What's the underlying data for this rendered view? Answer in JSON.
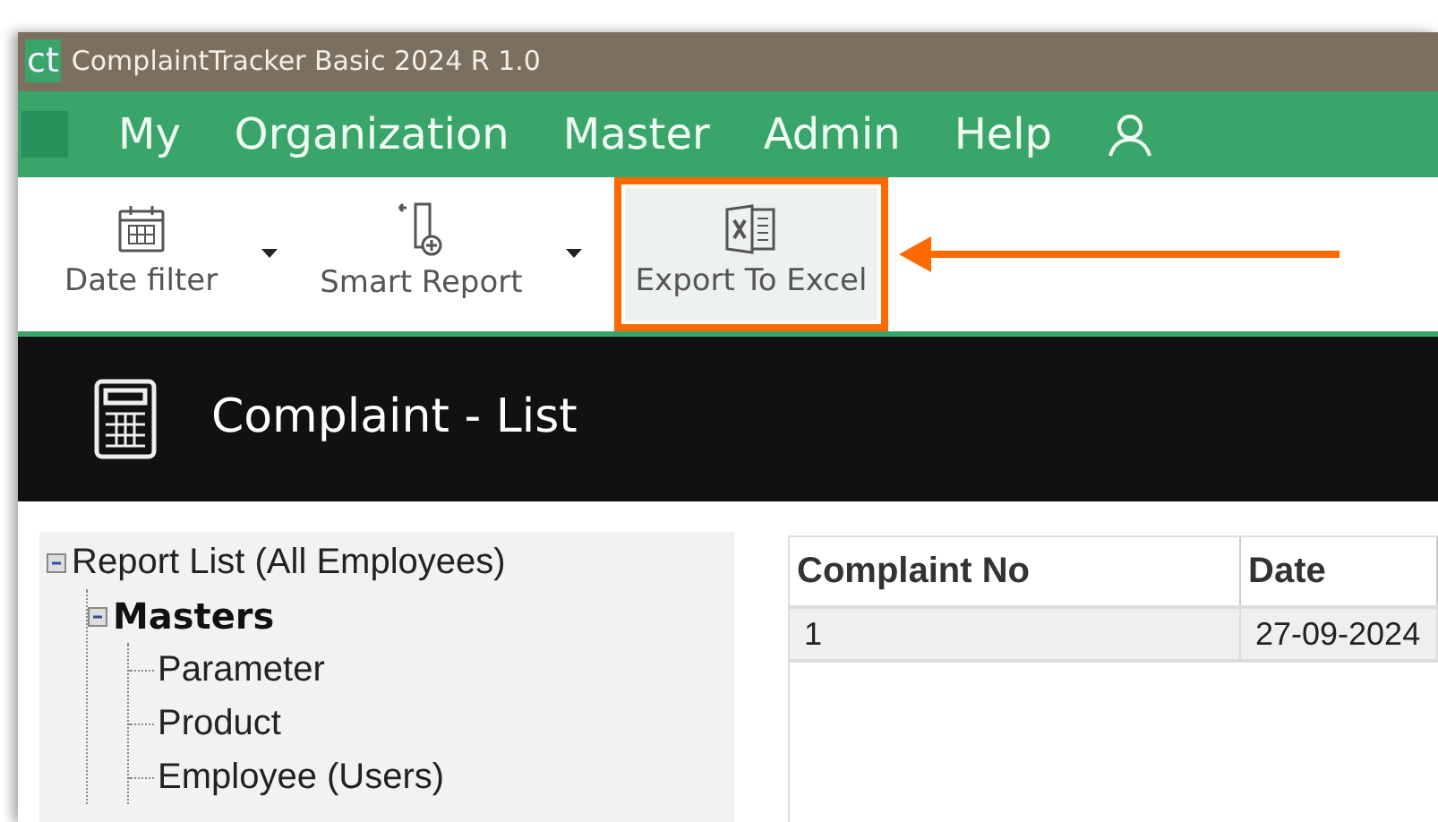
{
  "window": {
    "logo": "ct",
    "title": "ComplaintTracker Basic 2024 R 1.0"
  },
  "menu": [
    "My",
    "Organization",
    "Master",
    "Admin",
    "Help"
  ],
  "toolbar": [
    {
      "label": "Date filter",
      "kind": "calendar",
      "dropdown": true,
      "highlighted": false
    },
    {
      "label": "Smart Report",
      "kind": "report",
      "dropdown": true,
      "highlighted": false
    },
    {
      "label": "Export To Excel",
      "kind": "excel",
      "dropdown": false,
      "highlighted": true
    }
  ],
  "header": {
    "title": "Complaint - List"
  },
  "tree": [
    {
      "label": "Report List (All Employees)",
      "bold": false,
      "expanded": true,
      "children": [
        {
          "label": "Masters",
          "bold": true,
          "expanded": true,
          "children": [
            {
              "label": "Parameter",
              "bold": false
            },
            {
              "label": "Product",
              "bold": false
            },
            {
              "label": "Employee (Users)",
              "bold": false
            }
          ]
        }
      ]
    }
  ],
  "table": {
    "columns": [
      "Complaint No",
      "Date"
    ],
    "rows": [
      [
        "1",
        "27-09-2024"
      ]
    ]
  }
}
